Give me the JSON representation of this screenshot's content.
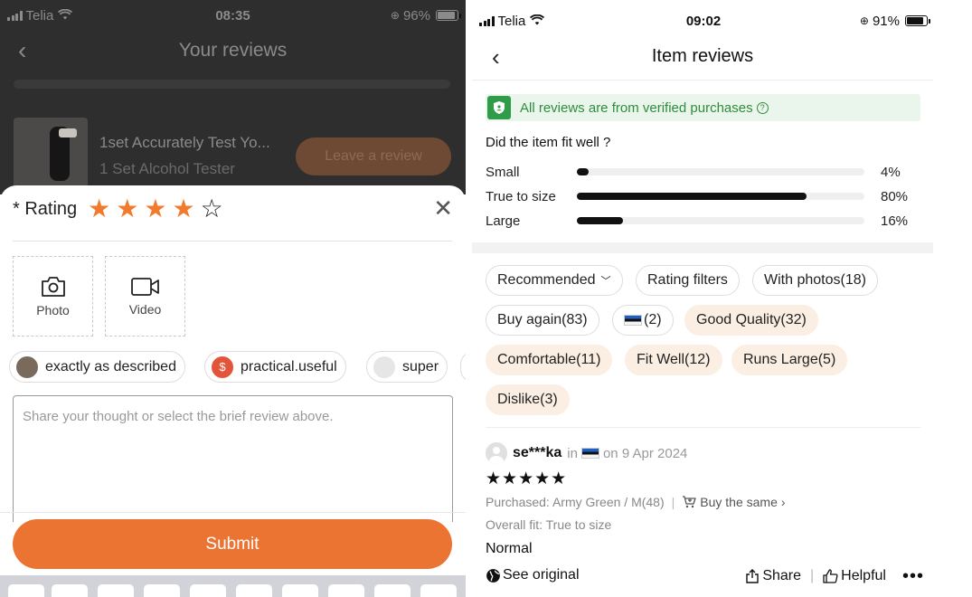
{
  "left": {
    "status": {
      "carrier": "Telia",
      "time": "08:35",
      "battery": "96%"
    },
    "nav": {
      "title": "Your reviews"
    },
    "product": {
      "title": "1set Accurately Test Yo...",
      "subtitle": "1 Set Alcohol Tester",
      "action": "Leave a review"
    },
    "sheet": {
      "rating_label": "* Rating",
      "rating_value": 4,
      "rating_max": 5,
      "upload": [
        {
          "label": "Photo",
          "icon": "camera-icon"
        },
        {
          "label": "Video",
          "icon": "video-camera-icon"
        }
      ],
      "chips": [
        "exactly as described",
        "practical.useful",
        "super"
      ],
      "textarea_placeholder": "Share your thought or select the brief review above.",
      "submit": "Submit"
    }
  },
  "right": {
    "status": {
      "carrier": "Telia",
      "time": "09:02",
      "battery": "91%"
    },
    "nav": {
      "title": "Item reviews"
    },
    "verified": "All reviews are from verified purchases",
    "fit": {
      "question": "Did the item fit well ?",
      "rows": [
        {
          "label": "Small",
          "value": 4,
          "display": "4%"
        },
        {
          "label": "True to size",
          "value": 80,
          "display": "80%"
        },
        {
          "label": "Large",
          "value": 16,
          "display": "16%"
        }
      ]
    },
    "filters": {
      "sort": "Recommended",
      "rating": "Rating filters",
      "photos": "With photos(18)",
      "buy_again": "Buy again(83)",
      "country_count": "(2)",
      "tags": [
        "Good Quality(32)",
        "Comfortable(11)",
        "Fit Well(12)",
        "Runs Large(5)",
        "Dislike(3)"
      ]
    },
    "review": {
      "user": "se***ka",
      "in": "in",
      "date": "on 9 Apr 2024",
      "stars": "★★★★★",
      "purchased": "Purchased: Army Green / M(48)",
      "buy_same": "Buy the same",
      "overall_fit": "Overall fit: True to size",
      "text": "Normal",
      "see_original": "See original",
      "share": "Share",
      "helpful": "Helpful"
    }
  }
}
